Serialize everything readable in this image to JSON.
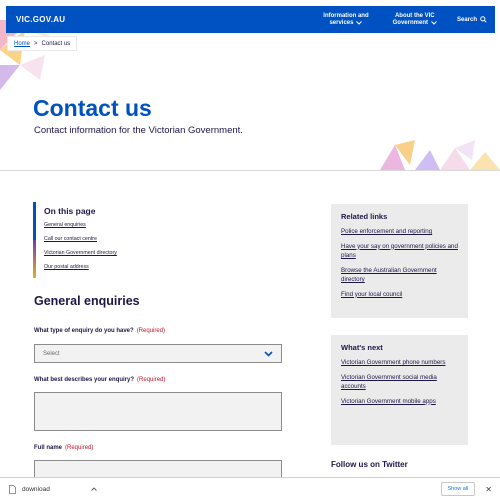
{
  "header": {
    "logo": "VIC.GOV.AU",
    "nav": [
      {
        "line1": "Information and",
        "line2": "services"
      },
      {
        "line1": "About the VIC",
        "line2": "Government"
      }
    ],
    "search_label": "Search",
    "brand_color": "#0052c2"
  },
  "breadcrumb": {
    "home": "Home",
    "separator": ">",
    "current": "Contact us"
  },
  "hero": {
    "title": "Contact us",
    "subtitle": "Contact information for the Victorian Government."
  },
  "on_this_page": {
    "title": "On this page",
    "links": [
      "General enquiries",
      "Call our contact centre",
      "Victorian Government directory",
      "Our postal address"
    ]
  },
  "form": {
    "section_title": "General enquiries",
    "required_text": "(Required)",
    "q1_label": "What type of enquiry do you have?",
    "select_placeholder": "Select",
    "q2_label": "What best describes your enquiry?",
    "q3_label": "Full name"
  },
  "related_links": {
    "title": "Related links",
    "links": [
      "Police enforcement and reporting",
      "Have your say on government policies and plans",
      "Browse the Australian Government directory",
      "Find your local council"
    ]
  },
  "whats_next": {
    "title": "What's next",
    "links": [
      "Victorian Government phone numbers",
      "Victorian Government social media accounts",
      "Victorian Government mobile apps"
    ]
  },
  "follow": {
    "title": "Follow us on Twitter"
  },
  "download_bar": {
    "filename": "download",
    "show_all": "Show all",
    "close": "✕"
  }
}
